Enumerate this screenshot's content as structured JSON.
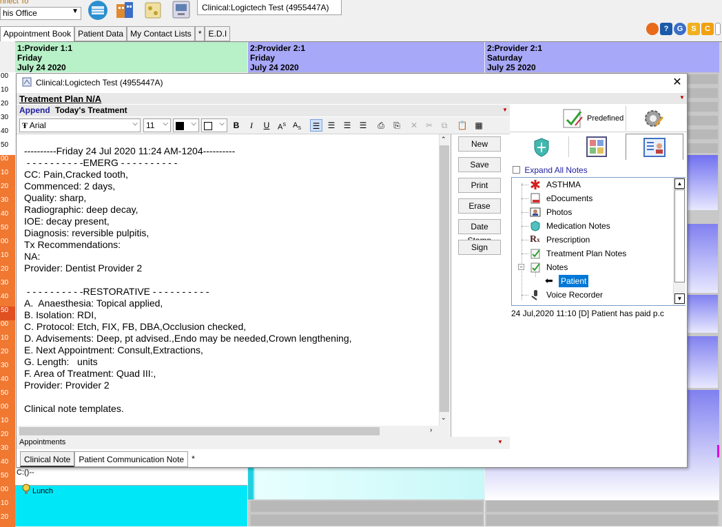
{
  "top": {
    "connect_label": "nnect To",
    "office_value": "his Office",
    "clinical_tab": "Clinical:Logictech Test (4955447A)"
  },
  "nav_tabs": [
    "Appointment Book",
    "Patient Data",
    "My Contact Lists",
    "*",
    "E.D.I"
  ],
  "top_right_icons": [
    {
      "icon": "orange-circle-icon",
      "label": "",
      "color": "#e86a1a"
    },
    {
      "icon": "help-icon",
      "label": "?",
      "color": "#1a5aa8"
    },
    {
      "icon": "g-icon",
      "label": "G",
      "color": "#3a6ec8"
    },
    {
      "icon": "s-icon",
      "label": "S",
      "color": "#f0b020"
    },
    {
      "icon": "c-icon",
      "label": "C",
      "color": "#f0a010"
    }
  ],
  "providers": [
    {
      "line1": "1:Provider 1:1",
      "line2": "Friday",
      "line3": "July 24 2020",
      "color": "#b8f0c8"
    },
    {
      "line1": "2:Provider 2:1",
      "line2": "Friday",
      "line3": "July 24 2020",
      "color": "#a8a8f8"
    },
    {
      "line1": "2:Provider 2:1",
      "line2": "Saturday",
      "line3": "July 25 2020",
      "color": "#a8a8f8"
    }
  ],
  "time_labels": [
    "00",
    "10",
    "20",
    "30",
    "40",
    "50",
    "00",
    "10",
    "20",
    "30",
    "40",
    "50",
    "00",
    "10",
    "20",
    "30",
    "40",
    "50",
    "00",
    "10",
    "20",
    "30",
    "40",
    "50",
    "00",
    "10",
    "20",
    "30",
    "40",
    "50",
    "00",
    "10",
    "20"
  ],
  "schedule": {
    "appt_code": "C:()--",
    "lunch_label": "Lunch"
  },
  "dialog": {
    "title": "Clinical:Logictech Test (4955447A)",
    "treatment_plan": "Treatment Plan N/A",
    "append_label": "Append",
    "todays_treatment": "Today's Treatment",
    "font_name": "Arial",
    "font_size": "11",
    "note_text": "----------Friday 24 Jul 2020 11:24 AM-1204----------\n - - - - - - - - - -EMERG - - - - - - - - - -\nCC: Pain,Cracked tooth,\nCommenced: 2 days,\nQuality: sharp,\nRadiographic: deep decay,\nIOE: decay present,\nDiagnosis: reversible pulpitis,\nTx Recommendations:\nNA:\nProvider: Dentist Provider 2\n\n - - - - - - - - - -RESTORATIVE - - - - - - - - - -\nA.  Anaesthesia: Topical applied,\nB. Isolation: RDI,\nC. Protocol: Etch, FIX, FB, DBA,Occlusion checked,\nD. Advisements: Deep, pt advised.,Endo may be needed,Crown lengthening,\nE. Next Appointment: Consult,Extractions,\nG. Length:   units\nF. Area of Treatment: Quad III:,\nProvider: Provider 2\n\nClinical note templates.",
    "side_buttons": [
      "New",
      "Save",
      "Print",
      "Erase",
      "Date Stamp",
      "Sign"
    ],
    "appointments_label": "Appointments",
    "bottom_tabs": [
      "Clinical Note",
      "Patient Communication Note",
      "*"
    ]
  },
  "right_panel": {
    "predefined_label": "Predefined",
    "expand_all": "Expand All Notes",
    "tree": [
      {
        "label": "ASTHMA",
        "icon": "medical-alert-icon"
      },
      {
        "label": "eDocuments",
        "icon": "document-icon"
      },
      {
        "label": "Photos",
        "icon": "photo-icon"
      },
      {
        "label": "Medication Notes",
        "icon": "shield-icon"
      },
      {
        "label": "Prescription",
        "icon": "rx-icon"
      },
      {
        "label": "Treatment Plan Notes",
        "icon": "treatment-plan-icon"
      },
      {
        "label": "Notes",
        "icon": "notes-icon"
      },
      {
        "label": "Patient",
        "icon": "arrow-left-icon"
      },
      {
        "label": "Voice Recorder",
        "icon": "microphone-icon"
      }
    ],
    "status_line": "24 Jul,2020 11:10   [D]   Patient has paid p.c"
  }
}
